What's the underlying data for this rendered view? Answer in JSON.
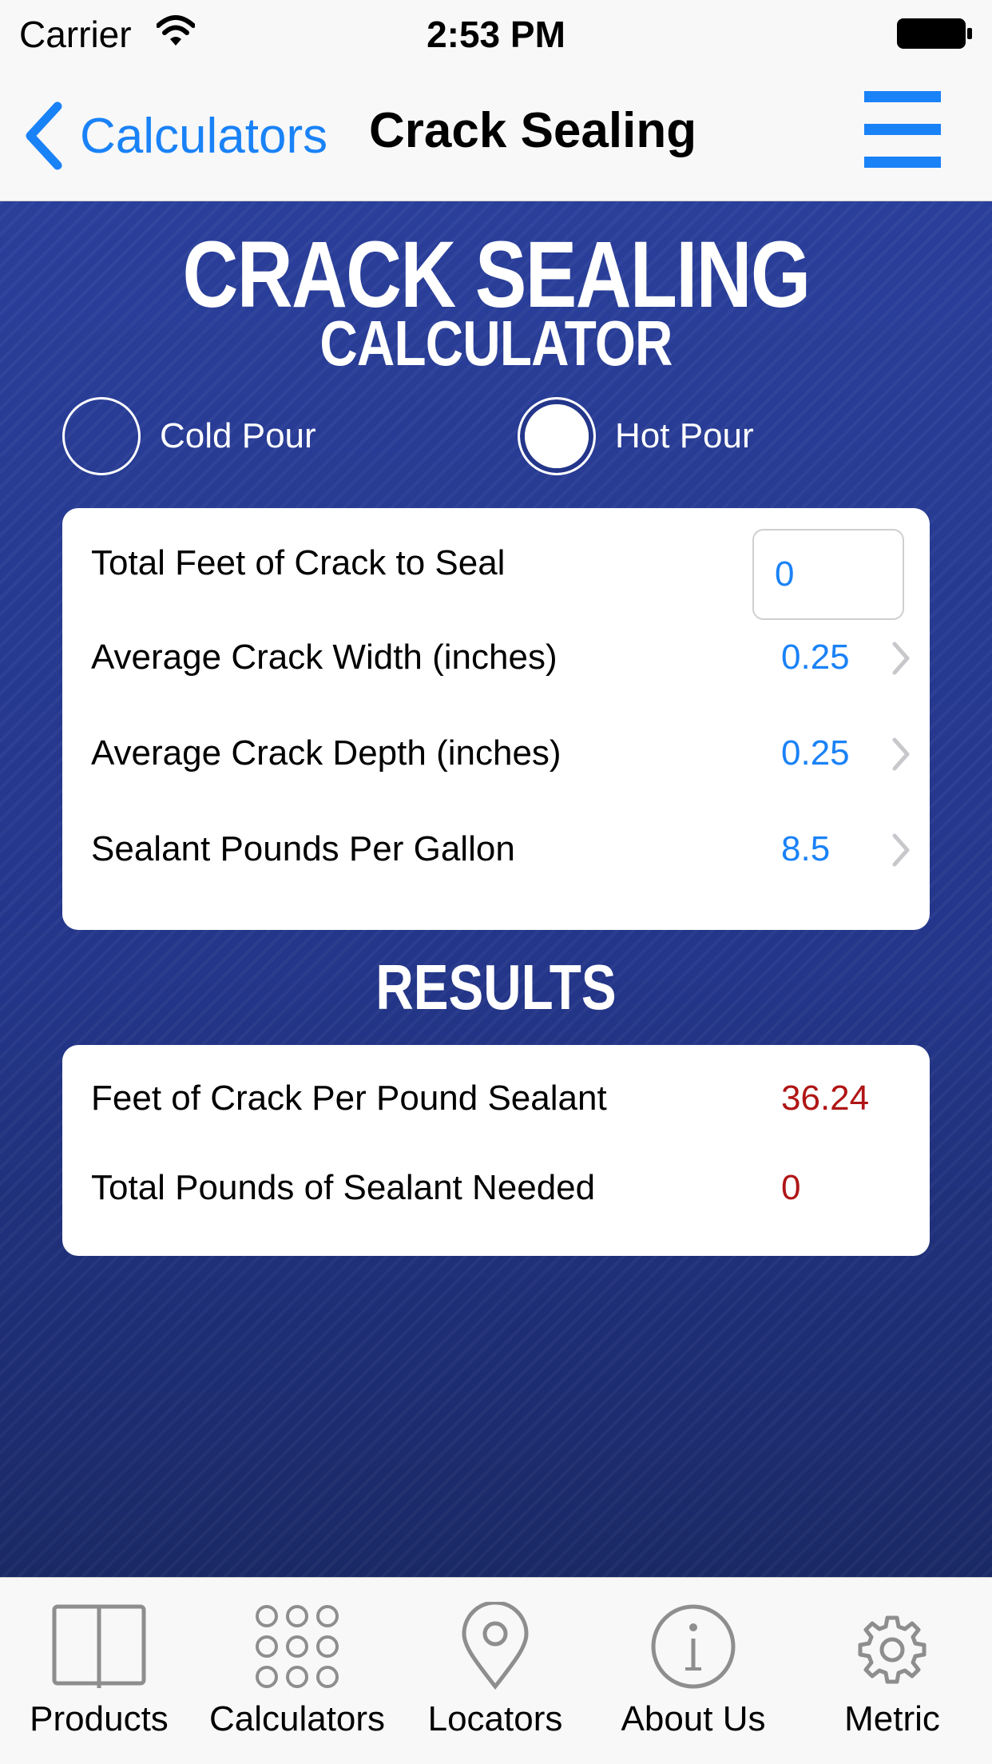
{
  "status_bar": {
    "carrier": "Carrier",
    "time": "2:53 PM",
    "wifi_icon": "wifi-icon",
    "battery_icon": "battery-icon"
  },
  "nav": {
    "back_label": "Calculators",
    "title": "Crack Sealing",
    "menu_icon": "hamburger-menu-icon",
    "accent_color": "#1a82f7"
  },
  "header": {
    "title_main": "CRACK SEALING",
    "title_sub": "CALCULATOR",
    "background_color": "#24368a"
  },
  "pour_options": [
    {
      "label": "Cold Pour",
      "selected": false
    },
    {
      "label": "Hot Pour",
      "selected": true
    }
  ],
  "inputs": {
    "total_feet": {
      "label": "Total Feet of Crack to Seal",
      "value": "0"
    },
    "rows": [
      {
        "label": "Average Crack Width (inches)",
        "value": "0.25"
      },
      {
        "label": "Average Crack Depth (inches)",
        "value": "0.25"
      },
      {
        "label": "Sealant Pounds Per Gallon",
        "value": "8.5"
      }
    ]
  },
  "results": {
    "title": "RESULTS",
    "value_color": "#b01515",
    "rows": [
      {
        "label": "Feet of Crack Per Pound Sealant",
        "value": "36.24"
      },
      {
        "label": "Total Pounds of Sealant Needed",
        "value": "0"
      }
    ]
  },
  "tab_bar": {
    "tabs": [
      {
        "label": "Products",
        "icon": "book-icon"
      },
      {
        "label": "Calculators",
        "icon": "grid-dots-icon"
      },
      {
        "label": "Locators",
        "icon": "map-pin-icon"
      },
      {
        "label": "About Us",
        "icon": "info-icon"
      },
      {
        "label": "Metric",
        "icon": "gear-icon"
      }
    ]
  }
}
